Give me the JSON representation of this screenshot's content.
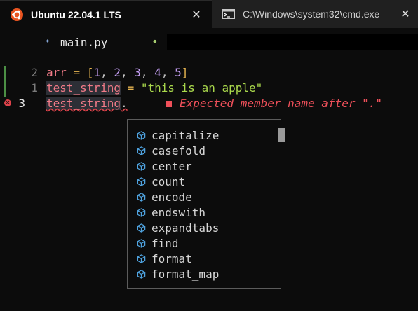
{
  "tabs": [
    {
      "title": "Ubuntu 22.04.1 LTS",
      "icon": "ubuntu-icon",
      "active": true,
      "close": "✕"
    },
    {
      "title": "C:\\Windows\\system32\\cmd.exe",
      "icon": "cmd-icon",
      "active": false,
      "close": "✕"
    }
  ],
  "editor": {
    "file_icon": "✦",
    "filename": "main.py",
    "modified_marker": "•",
    "lines": [
      {
        "number": "2",
        "code": {
          "var": "arr",
          "op": " = ",
          "list_open": "[",
          "items": [
            "1",
            "2",
            "3",
            "4",
            "5"
          ],
          "list_close": "]"
        }
      },
      {
        "number": "1",
        "code": {
          "var": "test_string",
          "op": " = ",
          "string": "\"this is an apple\""
        }
      },
      {
        "number": "3",
        "code": {
          "var": "test_string",
          "dot": "."
        },
        "error": true,
        "diagnostic": "Expected member name after \".\""
      }
    ]
  },
  "completion": {
    "items": [
      "capitalize",
      "casefold",
      "center",
      "count",
      "encode",
      "endswith",
      "expandtabs",
      "find",
      "format",
      "format_map"
    ],
    "item_icon": "method-cube-icon"
  },
  "colors": {
    "error": "#f0505a",
    "string": "#aad94c",
    "variable": "#f27b88",
    "number": "#c6a0f6",
    "operator": "#e6b450",
    "method_icon": "#4fa3e0"
  }
}
